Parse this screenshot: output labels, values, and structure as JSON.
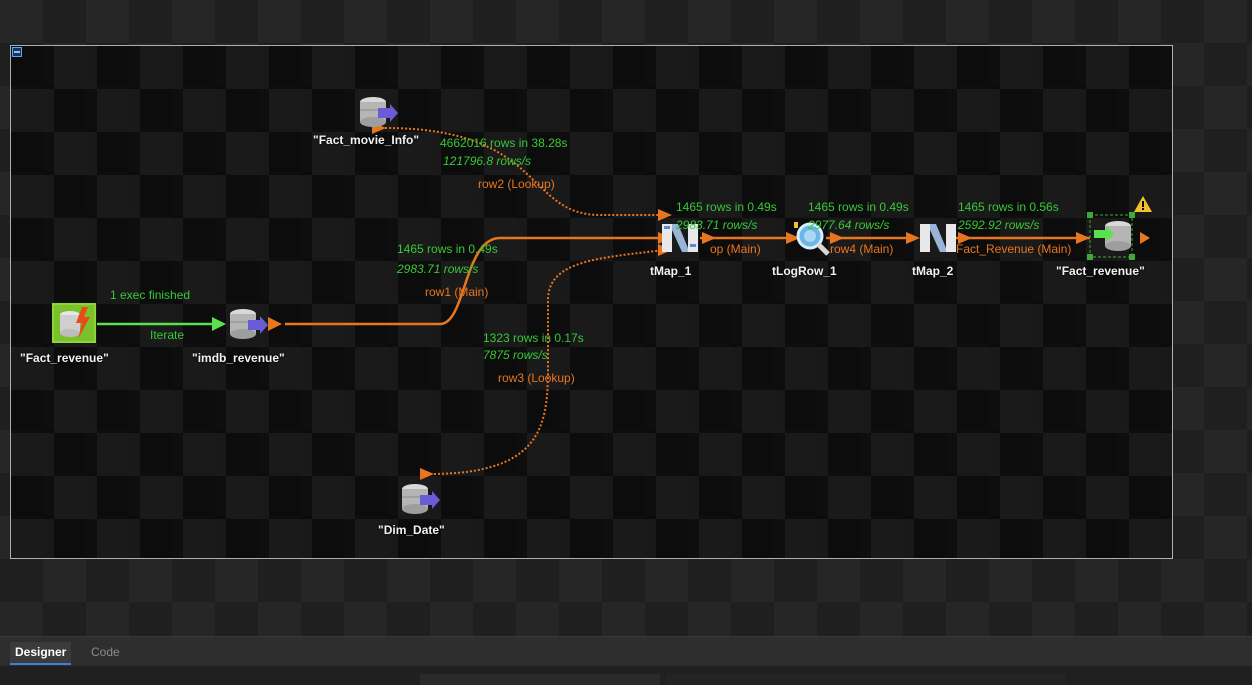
{
  "tabs": {
    "designer": "Designer",
    "code": "Code"
  },
  "components": {
    "fact_revenue_input": "\"Fact_revenue\"",
    "imdb_revenue": "\"imdb_revenue\"",
    "fact_movie_info": "\"Fact_movie_Info\"",
    "dim_date": "\"Dim_Date\"",
    "tmap_1": "tMap_1",
    "tlogrow_1": "tLogRow_1",
    "tmap_2": "tMap_2",
    "fact_revenue_output": "\"Fact_revenue\""
  },
  "links": {
    "iterate": {
      "label": "Iterate",
      "status": "1 exec finished"
    },
    "row1": {
      "label": "row1 (Main)",
      "stats": "1465 rows in 0.49s",
      "rate": "2983.71 rows/s"
    },
    "row2": {
      "label": "row2 (Lookup)",
      "stats": "4662016 rows in 38.28s",
      "rate": "121796.8 rows/s"
    },
    "row3": {
      "label": "row3 (Lookup)",
      "stats": "1323 rows in 0.17s",
      "rate": "7875 rows/s"
    },
    "out_main": {
      "label": "op (Main)",
      "stats": "1465 rows in 0.49s",
      "rate": "2983.71 rows/s"
    },
    "row4": {
      "label": "row4 (Main)",
      "stats": "1465 rows in 0.49s",
      "rate": "2977.64 rows/s"
    },
    "fact_revenue_link": {
      "label": "Fact_Revenue (Main)",
      "stats": "1465 rows in 0.56s",
      "rate": "2592.92 rows/s"
    }
  },
  "colors": {
    "main_link": "#e8761f",
    "iterate_link": "#5be04e",
    "stats_text": "#37c837",
    "frame_border": "#a9b0b8",
    "warning": "#f2c12e"
  }
}
